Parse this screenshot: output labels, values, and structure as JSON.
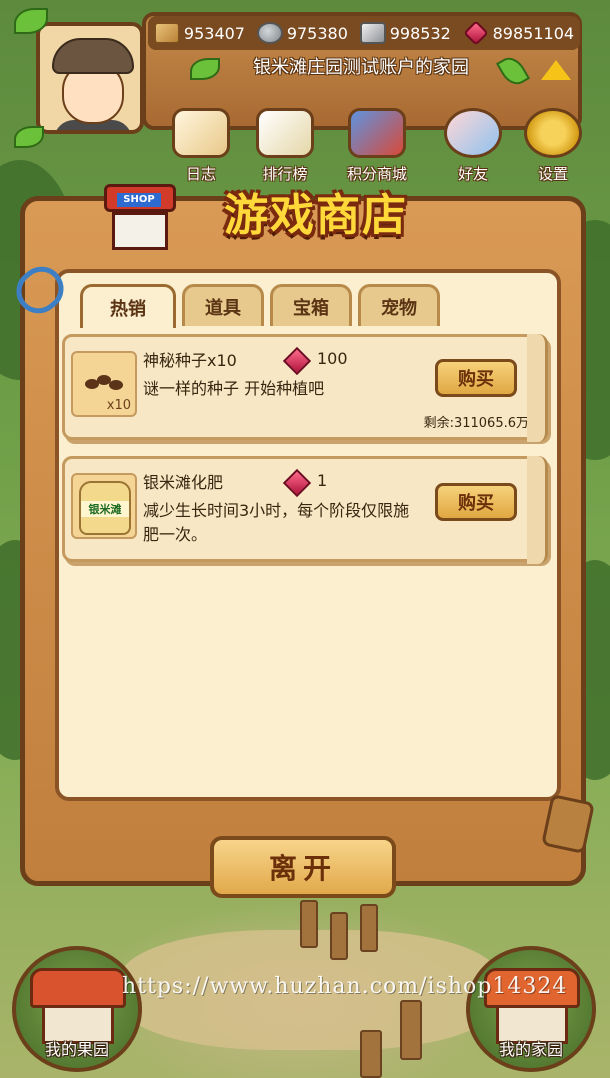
{
  "resources": [
    {
      "icon": "wood-icon",
      "value": "953407"
    },
    {
      "icon": "stone-icon",
      "value": "975380"
    },
    {
      "icon": "metal-icon",
      "value": "998532"
    },
    {
      "icon": "gem-icon",
      "value": "89851104"
    }
  ],
  "home_name": "银米滩庄园测试账户的家园",
  "menu": [
    {
      "icon": "diary-icon",
      "label": "日志"
    },
    {
      "icon": "leaderboard-icon",
      "label": "排行榜"
    },
    {
      "icon": "points-shop-icon",
      "label": "积分商城"
    },
    {
      "icon": "friends-icon",
      "label": "好友"
    },
    {
      "icon": "settings-gear-icon",
      "label": "设置"
    }
  ],
  "shop": {
    "title": "游戏商店",
    "shop_sign": "SHOP",
    "tabs": [
      "热销",
      "道具",
      "宝箱",
      "宠物"
    ],
    "active_tab": "热销",
    "items": [
      {
        "name": "神秘种子x10",
        "thumb_qty": "x10",
        "price": "100",
        "description": "谜一样的种子 开始种植吧",
        "buy_label": "购买",
        "remaining": "剩余:311065.6万"
      },
      {
        "name": "银米滩化肥",
        "thumb_label": "银米滩",
        "price": "1",
        "description": "减少生长时间3小时，每个阶段仅限施肥一次。",
        "buy_label": "购买"
      }
    ],
    "leave_label": "离开"
  },
  "bottom_nav": {
    "left_label": "我的果园",
    "right_label": "我的家园"
  },
  "watermark": "https://www.huzhan.com/ishop14324"
}
